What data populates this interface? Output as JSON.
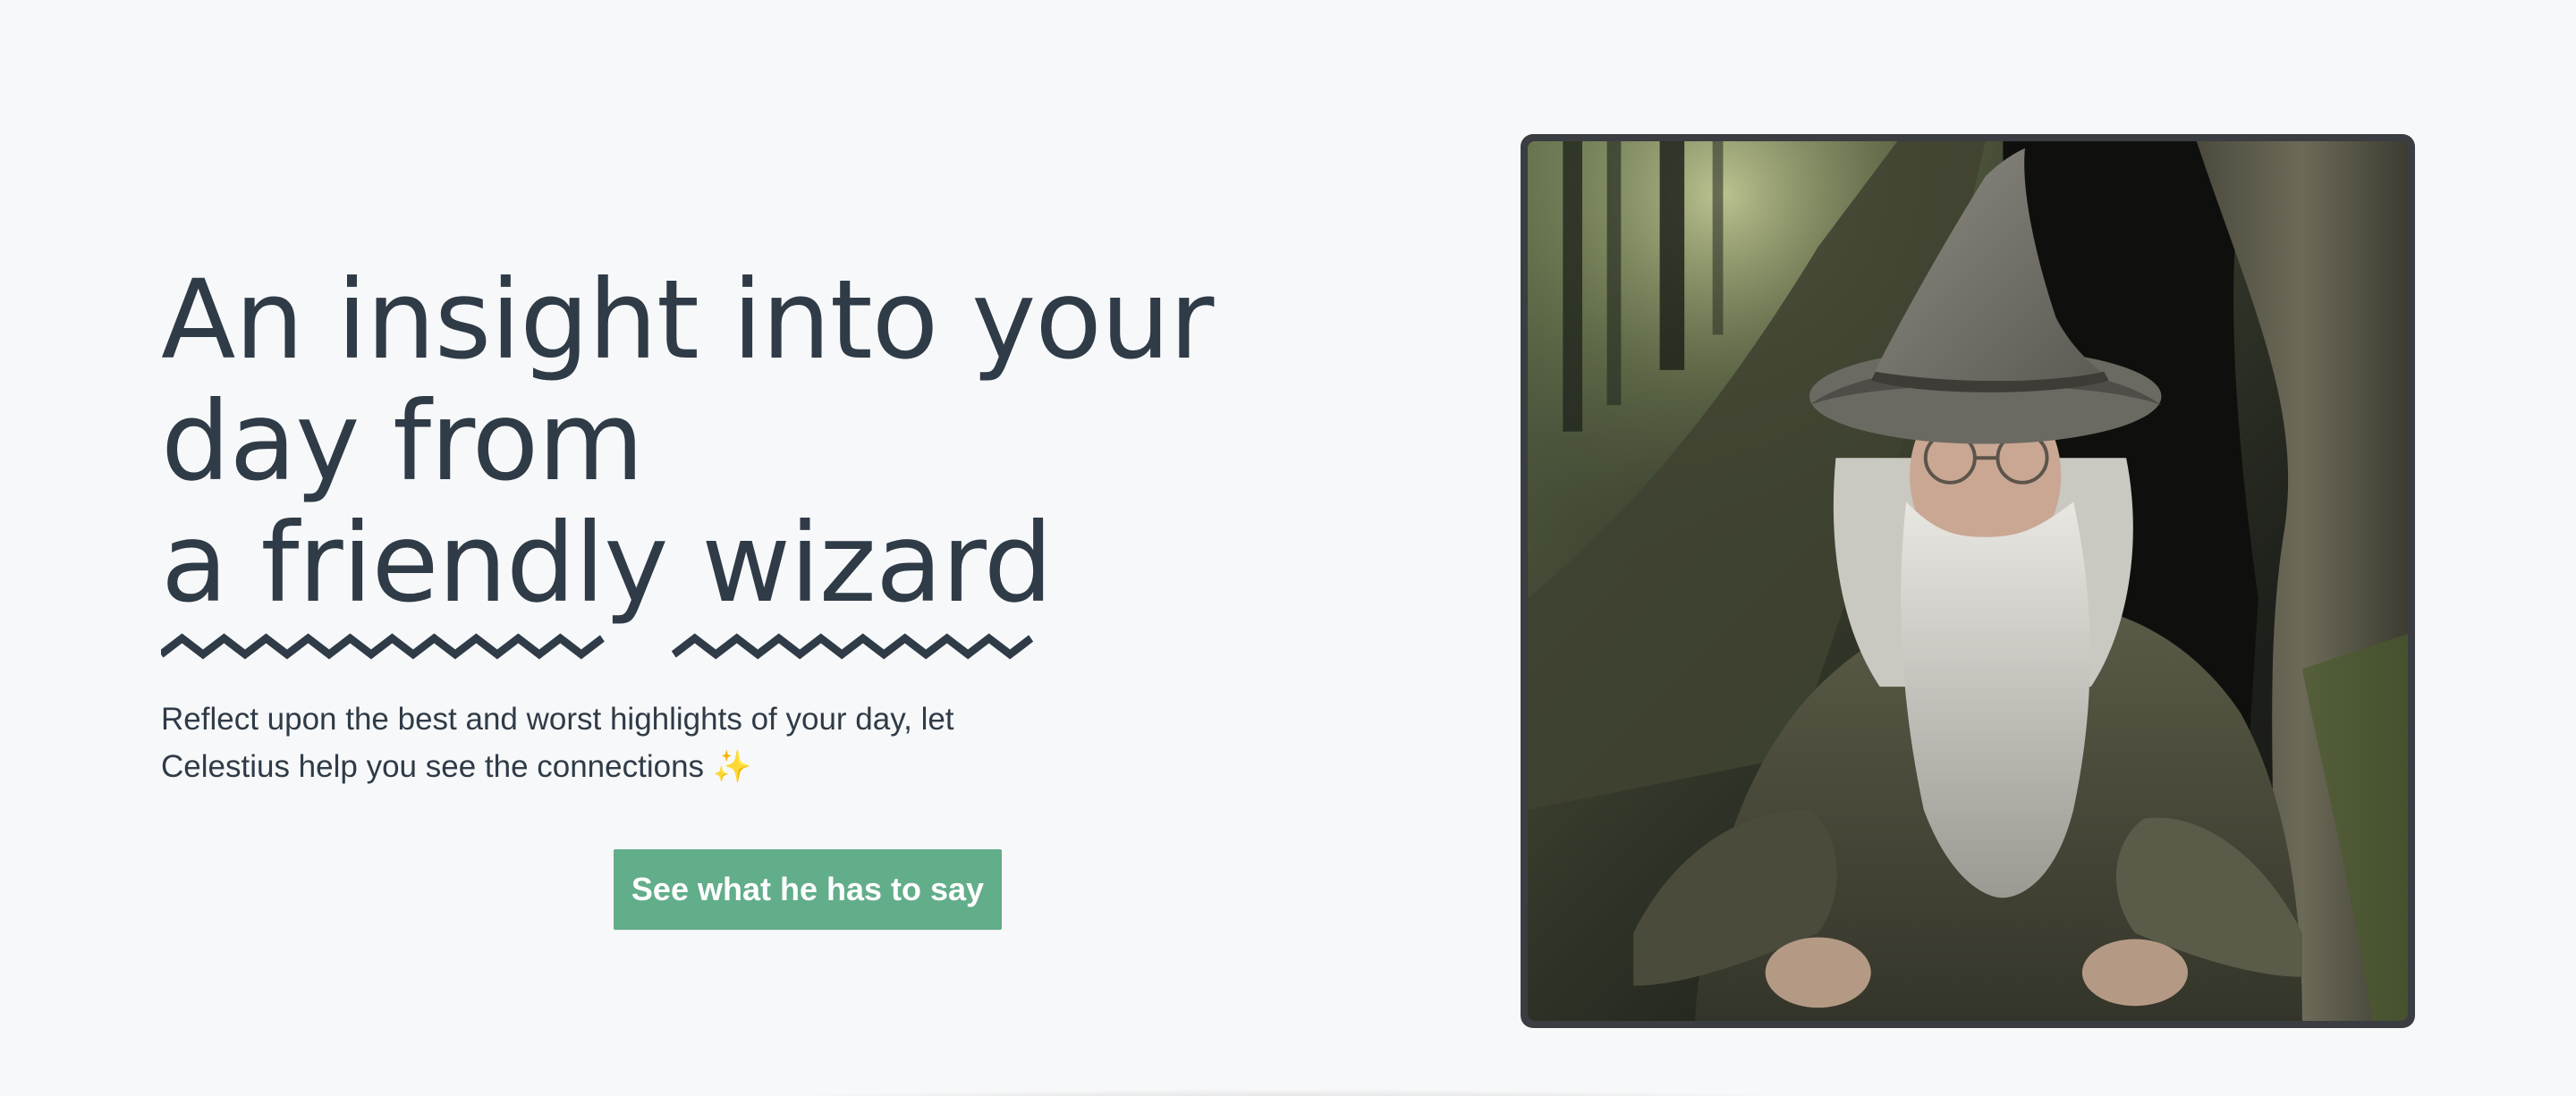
{
  "hero": {
    "headline_line1": "An insight into your",
    "headline_line2": "day from",
    "headline_line3": "a friendly wizard",
    "subtext": "Reflect upon the best and worst highlights of your day, let Celestius help you see the connections ✨",
    "cta_label": "See what he has to say"
  },
  "image": {
    "alt": "wizard-portrait"
  },
  "colors": {
    "text": "#2f3b47",
    "background": "#f7f8f9",
    "cta_bg": "#62ad8a",
    "cta_text": "#ffffff",
    "frame": "#3a3d41"
  }
}
